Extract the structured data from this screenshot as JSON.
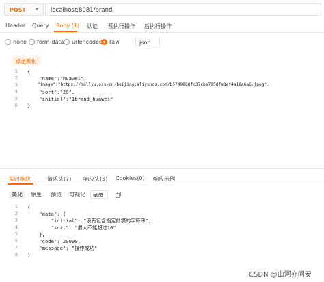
{
  "request": {
    "method": "POST",
    "url": "localhost:8081/brand"
  },
  "request_tabs": [
    "Header",
    "Query",
    "Body (1)",
    "认证",
    "预执行操作",
    "后执行操作"
  ],
  "body_types": {
    "options": [
      "none",
      "form-data",
      "urlencoded",
      "raw"
    ],
    "selected": "raw",
    "format": "json"
  },
  "beautify_label": "点击美化",
  "request_body": {
    "line_numbers": [
      "1",
      "2",
      "3",
      "4",
      "5",
      "6"
    ],
    "lines": [
      "{",
      "    \"name\":\"huawei\",",
      "    \"image\":\"https://mallyu.oss-cn-beijing.aliyuncs.com/b5749988fc37cbe795dfe8ef4a18a6a6.jpeg\",",
      "    \"sort\":\"20\",",
      "    \"initial\":\"1brand_huawei\"",
      "}"
    ]
  },
  "response_tabs": [
    "实时响应",
    "请求头(7)",
    "响应头(5)",
    "Cookies(0)",
    "响应示例"
  ],
  "view_modes": {
    "buttons": [
      "美化",
      "原生",
      "预览",
      "可视化"
    ],
    "encoding": "utf8"
  },
  "response_body": {
    "line_numbers": [
      "1",
      "2",
      "3",
      "4",
      "5",
      "6",
      "7",
      "8"
    ],
    "lines": [
      "{",
      "    \"data\": {",
      "        \"initial\": \"没有包含指定前缀的字符串\",",
      "        \"sort\": \"最大不能超过10\"",
      "    },",
      "    \"code\": 20000,",
      "    \"message\": \"操作成功\"",
      "}"
    ]
  },
  "watermark": "CSDN @山河亦问安",
  "colors": {
    "accent": "#ff6a00"
  }
}
